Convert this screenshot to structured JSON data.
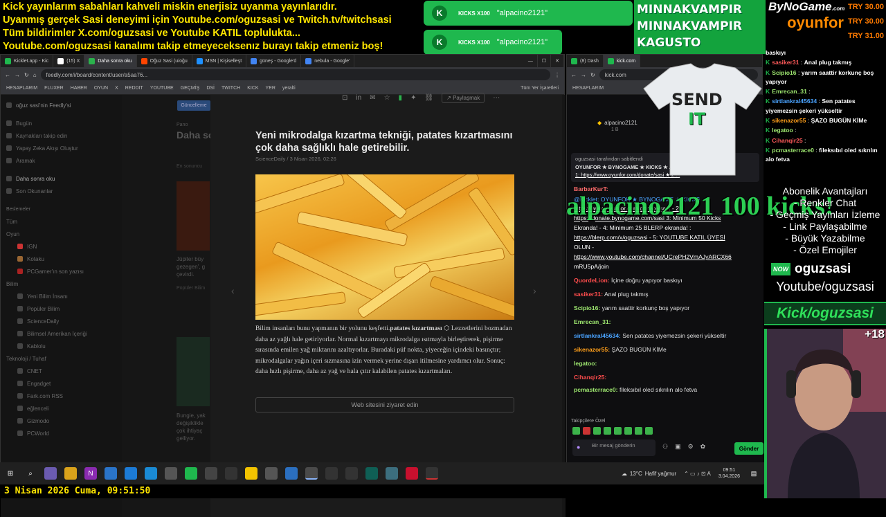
{
  "overlay": {
    "top_lines": [
      "Kick yayınlarım sabahları kahveli miskin enerjisiz uyanma yayınlarıdır.",
      "Uyanmış gerçek Sasi deneyimi için Youtube.com/oguzsasi ve Twitch.tv/twitchsasi",
      "Tüm bildirimler X.com/oguzsasi ve Youtube KATIL toplulukta...",
      "Youtube.com/oguzsasi kanalımı takip etmeyeceksenız burayı takip etmeniz boş!"
    ],
    "alerts": [
      {
        "tag": "KICKS X100",
        "user": "\"alpacino2121\""
      },
      {
        "tag": "KICKS X100",
        "user": "\"alpacino2121\""
      }
    ],
    "names": [
      "MINNAKVAMPIR",
      "MINNAKVAMPIR",
      "KAGUSTO"
    ],
    "logo_top": "ByNoGame",
    "logo_small": ".com",
    "logo_bottom": "oyunfor",
    "donations": [
      "TRY 30.00",
      "TRY 30.00",
      "TRY 31.00"
    ],
    "big_kicks": "alpacino2121 100 kicks!",
    "shirt_text_1": "SEND",
    "shirt_text_2": "IT",
    "subscription": {
      "title": "Abonelik Avantajları",
      "items": [
        "- Renkler Chat",
        "- Geçmiş Yayınları İzleme",
        "- Link Paylaşabilme",
        "- Büyük Yazabilme",
        "- Özel Emojiler"
      ]
    },
    "now_badge": "NOW",
    "channel_name": "oguzsasi",
    "youtube": "Youtube/oguzsasi",
    "kick": "Kick/oguzsasi",
    "viewer_badge": "+18",
    "date_clock": "3 Nisan 2026 Cuma, 09:51:50"
  },
  "feedly": {
    "tabs": [
      "Kicklet.app - Kic",
      "(15) X",
      "Daha sonra oku",
      "Oğuz Sasi (u/oğu",
      "MSN | Kişiselleşt",
      "güneş - Google'd",
      "nebula - Google'"
    ],
    "url": "feedly.com/i/board/content/user/a5aa76...",
    "bookmarks": [
      "HESAPLARIM",
      "FLUXER",
      "HABER",
      "OYUN",
      "X",
      "REDDIT",
      "YOUTUBE",
      "GEÇMİŞ",
      "DSİ",
      "TWITCH",
      "KICK",
      "YER",
      "yeralti"
    ],
    "bookmark_right": "Tüm Yer İşaretleri",
    "sidebar_header": "oğuz sasi'nin Feedly'si",
    "sidebar_top": [
      "Bugün",
      "Kaynakları takip edin",
      "Yapay Zeka Akışı Oluştur",
      "Aramak"
    ],
    "sidebar_saved": [
      "Daha sonra oku",
      "Son Okunanlar"
    ],
    "sidebar_feeds_label": "Beslemeler",
    "sidebar_all": "Tüm",
    "sidebar_oyun": "Oyun",
    "sidebar_oyun_items": [
      "IGN",
      "Kotaku",
      "PCGamer'ın son yazısı"
    ],
    "sidebar_bilim": "Bilim",
    "sidebar_bilim_items": [
      "Yeni Bilim İnsanı",
      "Popüler Bilim",
      "ScienceDaily",
      "Bilimsel Amerikan İçeriği",
      "Kablolu"
    ],
    "sidebar_tek": "Teknoloji / Tuhaf",
    "sidebar_tek_items": [
      "CNET",
      "Engadget",
      "Fark.com RSS",
      "eğlenceli",
      "Gizmodo",
      "PCWorld"
    ],
    "update_btn": "Güncelleme",
    "bg_pano": "Pano",
    "bg_title": "Daha so",
    "bg_label": "En sonuncu",
    "bg_story1": "Jüpiter büy gezegen', g çevirdi.",
    "bg_story1_src": "Popüler Bilim",
    "bg_story2": "Bungie, yak değişiklikle çok ihtiyaç gelliyor.",
    "share_label": "Paylaşmak",
    "article_title": "Yeni mikrodalga kızartma tekniği, patates kızartmasını çok daha sağlıklı hale getirebilir.",
    "article_meta": "ScienceDaily / 3 Nisan 2026, 02:26",
    "article_lead": "Bilim insanları bunu yapmanın bir yolunu keşfetti.",
    "article_bold": "patates kızartması",
    "article_body": "Lezzetlerini bozmadan daha az yağlı hale getiriyorlar. Normal kızartmayı mikrodalga ısıtmayla birleştirerek, pişirme sırasında emilen yağ miktarını azaltıyorlar. Buradaki püf nokta, yiyeceğin içindeki basınçtır; mikrodalgalar yağın içeri sızmasına izin vermek yerine dışarı itilmesine yardımcı olur. Sonuç: daha hızlı pişirme, daha az yağ ve hala çıtır kalabilen patates kızartmaları.",
    "visit_btn": "Web sitesini ziyaret edin"
  },
  "chat": {
    "tabs": [
      "(8) Dash",
      "kick.com"
    ],
    "url": "kick.com",
    "bookmarks": [
      "HESAPLARIM"
    ],
    "top_user": "alpacino2121",
    "top_amount": "1 B",
    "pin_by": "oguzsasi tarafından sabitlendi",
    "pin_text": "OYUNFOR ★ BYNOGAME ★ KICKS ★ ... ATIL ★",
    "pin_link": "1: https://www.oyunfor.com/donate/sasi ★ 2:...",
    "messages": [
      {
        "user": "BarbarKurT:",
        "text": "",
        "color": "#ff6b6b"
      },
      {
        "user": "",
        "text": "@Kicklet: OYUNFOR ★ BYNOGAME ★ KICKS",
        "color": "#4aa3ff"
      },
      {
        "user": "",
        "text": "https://www.oyunfor.com/donate/sasi - 2:",
        "color": "#fff"
      },
      {
        "user": "",
        "text": "https://donate.bynogame.com/sasi 3: Minimum 50 Kicks",
        "color": "#fff"
      },
      {
        "user": "",
        "text": "Ekranda! - 4: Minimum 25 BLERP ekranda! :",
        "color": "#fff"
      },
      {
        "user": "",
        "text": "https://blerp.com/x/oguzsasi - 5: YOUTUBE KATIL ÜYESİ",
        "color": "#fff"
      },
      {
        "user": "",
        "text": "OLUN -",
        "color": "#fff"
      },
      {
        "user": "",
        "text": "https://www.youtube.com/channel/UCrePH2VmAJyARCX66",
        "color": "#fff"
      },
      {
        "user": "",
        "text": "mRU5pA/join",
        "color": "#fff"
      },
      {
        "user": "QuordeLion:",
        "text": "İçine doğru yapıyor baskıyı",
        "color": "#ff4d4d"
      },
      {
        "user": "sasiker31:",
        "text": "Anal plug takmış",
        "color": "#ff4d4d"
      },
      {
        "user": "Scipio16:",
        "text": "yarım saattir korkunç boş yapıyor",
        "color": "#9fe870"
      },
      {
        "user": "Emrecan_31:",
        "text": "",
        "color": "#9fe870"
      },
      {
        "user": "sirtlankral45634:",
        "text": "Sen patates yiyemezsin şekeri yükseltir",
        "color": "#4aa3ff"
      },
      {
        "user": "sikenazor55:",
        "text": "ŞAZO BUGÜN KİMe",
        "color": "#ff9f1a"
      },
      {
        "user": "legatoo:",
        "text": "",
        "color": "#9fe870"
      },
      {
        "user": "Cihanqir25:",
        "text": "",
        "color": "#ff4d4d"
      },
      {
        "user": "pcmasterrace0:",
        "text": "fileksıbıl oled sıkrılın alo fetva",
        "color": "#9fe870"
      }
    ],
    "followers_label": "Takipçilere Özel",
    "input_placeholder": "Bir mesaj gönderin",
    "send_btn": "Gönder"
  },
  "right_chat": [
    {
      "user": "",
      "text": "baskıyı",
      "color": "#fff"
    },
    {
      "user": "sasiker31",
      "text": "Anal plug takmış",
      "color": "#ff5a5a"
    },
    {
      "user": "Scipio16",
      "text": "yarım saattir korkunç boş yapıyor",
      "color": "#9fe870"
    },
    {
      "user": "Emrecan_31",
      "text": "",
      "color": "#9fe870"
    },
    {
      "user": "sirtlankral45634",
      "text": "Sen patates yiyemezsin şekeri yükseltir",
      "color": "#4aa3ff"
    },
    {
      "user": "sikenazor55",
      "text": "ŞAZO BUGÜN KİMe",
      "color": "#ff9f1a"
    },
    {
      "user": "legatoo",
      "text": "",
      "color": "#9fe870"
    },
    {
      "user": "Cihanqir25",
      "text": "",
      "color": "#ff5a5a"
    },
    {
      "user": "pcmasterrace0",
      "text": "fileksıbıl oled sıkrılın alo fetva",
      "color": "#9fe870"
    }
  ],
  "taskbar": {
    "weather": "13°C",
    "weather_desc": "Hafif yağmur",
    "time": "09:51",
    "date": "3.04.2026"
  }
}
